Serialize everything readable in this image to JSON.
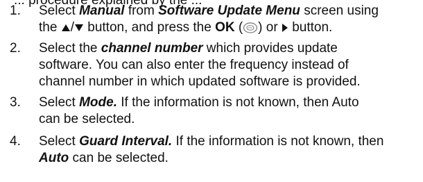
{
  "cutoff_text": "... procedure explained by the ...",
  "steps": [
    {
      "number": "1.",
      "line1": {
        "a": "Select ",
        "b": "Manual",
        "c": " from ",
        "d": "Software Update Menu",
        "e": " screen using"
      },
      "line2": {
        "a": "the ",
        "b": " button, and press the ",
        "c": "OK",
        "d": " (",
        "e": ") or ",
        "f": " button."
      }
    },
    {
      "number": "2.",
      "line1": {
        "a": "Select the ",
        "b": "channel number",
        "c": " which provides update"
      },
      "line2": "software. You can also enter the frequency instead of",
      "line3": "channel number in which updated software is provided."
    },
    {
      "number": "3.",
      "line1": {
        "a": "Select ",
        "b": "Mode.",
        "c": " If the information is not known, then Auto"
      },
      "line2": "can be selected."
    },
    {
      "number": "4.",
      "line1": {
        "a": "Select ",
        "b": "Guard Interval.",
        "c": " If the information is not known, then"
      },
      "line2": {
        "a": "Auto",
        "b": " can be selected."
      }
    }
  ]
}
